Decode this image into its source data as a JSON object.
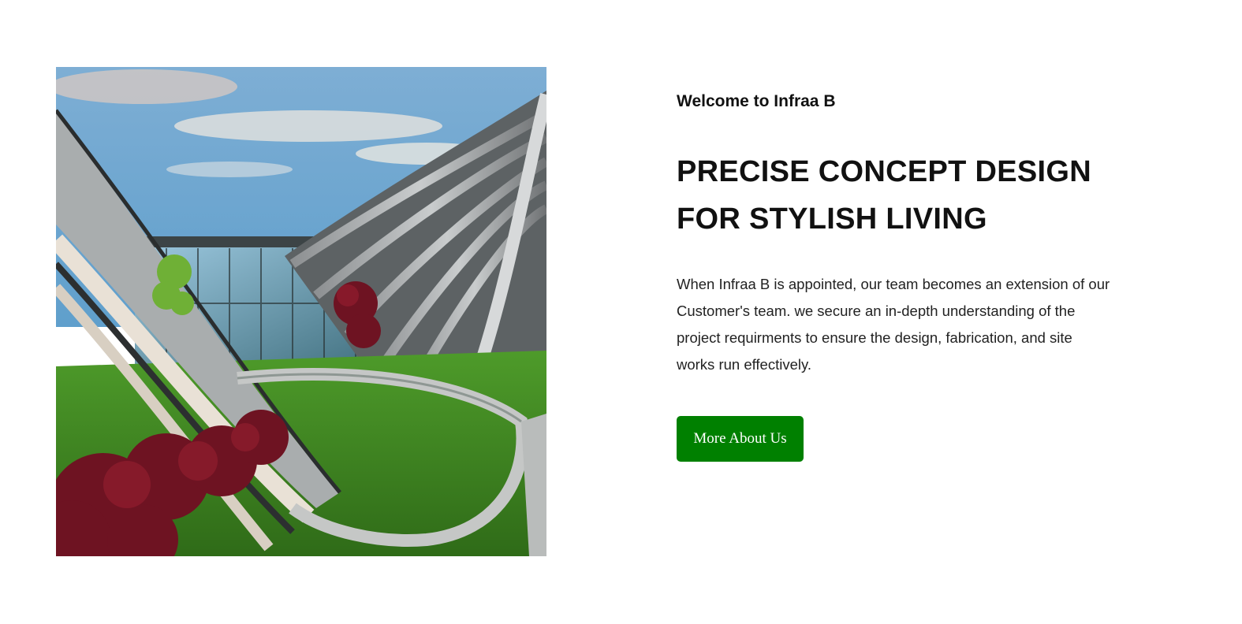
{
  "hero_image": {
    "alt": "Curved modern building with glass facade, wavy steel roof ribs and a sweeping footbridge over landscaped gardens"
  },
  "section": {
    "eyebrow": "Welcome to Infraa B",
    "headline_line1": "PRECISE CONCEPT DESIGN",
    "headline_line2": "FOR STYLISH LIVING",
    "description": "When Infraa B is appointed, our team becomes an extension of our Customer's team. we secure an in-depth understanding of the project requirments to ensure the design, fabrication, and site works run effectively.",
    "button_label": "More About Us"
  },
  "colors": {
    "button_bg": "#008000",
    "text": "#111111",
    "background": "#ffffff"
  }
}
